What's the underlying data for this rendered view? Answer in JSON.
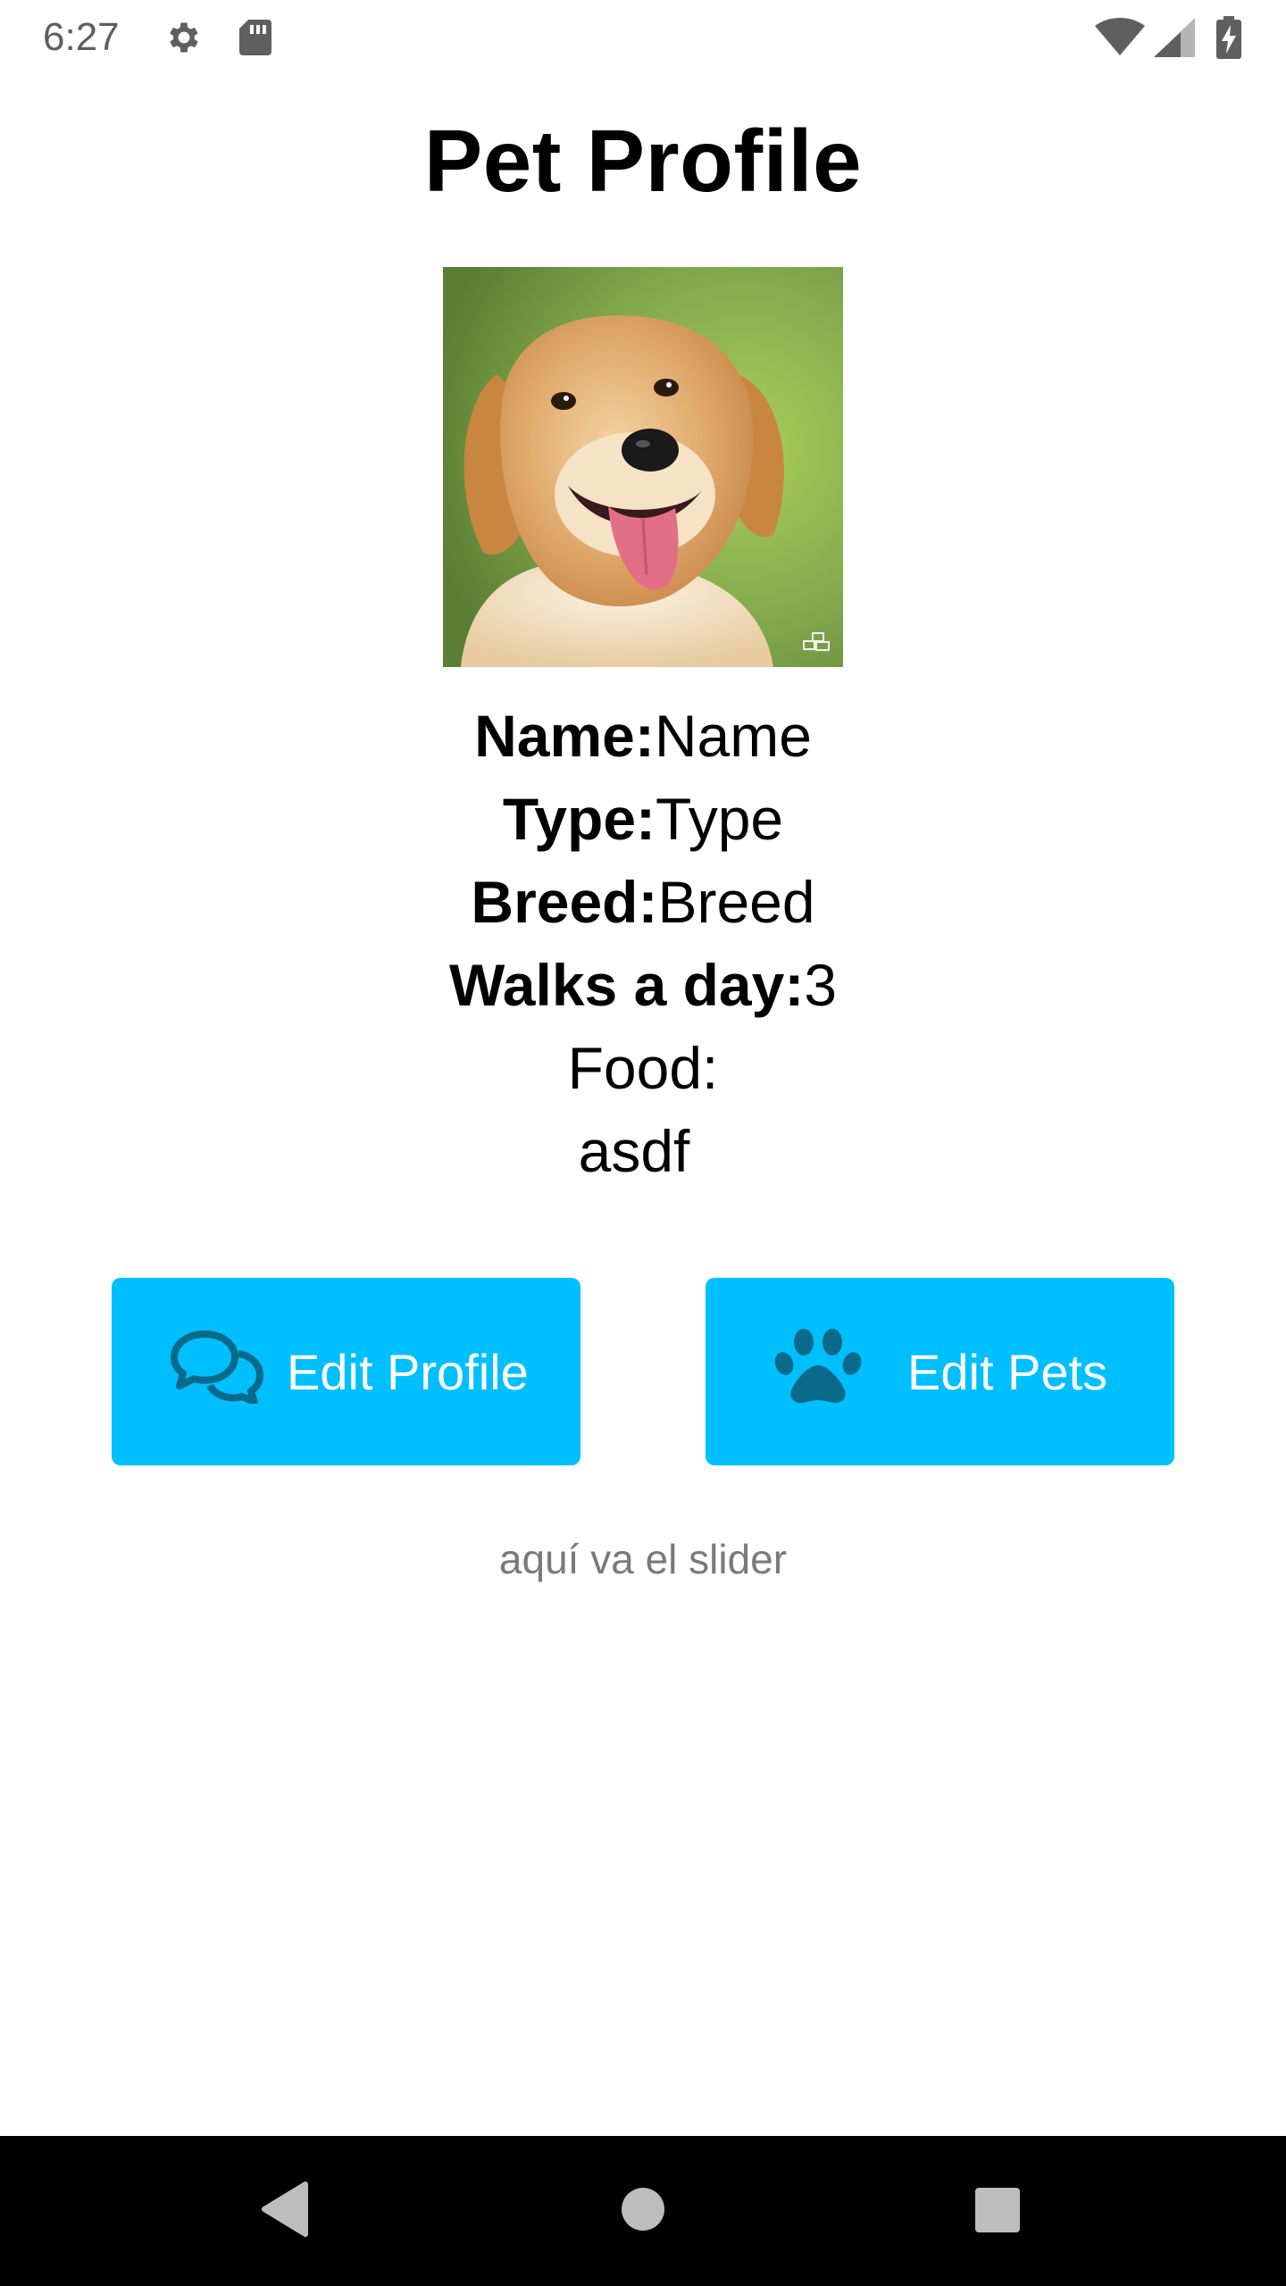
{
  "status_bar": {
    "time": "6:27",
    "icons": [
      "gear-icon",
      "sd-card-icon",
      "wifi-icon",
      "signal-icon",
      "battery-charging-icon"
    ]
  },
  "page": {
    "title": "Pet Profile"
  },
  "pet": {
    "photo": "dog-photo",
    "name_label": "Name:",
    "name_value": "Name",
    "type_label": "Type:",
    "type_value": "Type",
    "breed_label": "Breed:",
    "breed_value": "Breed",
    "walks_label": "Walks a day:",
    "walks_value": "3",
    "food_label": "Food:",
    "food_value": "asdf"
  },
  "buttons": {
    "edit_profile": {
      "label": "Edit Profile",
      "icon": "chat-bubbles-icon"
    },
    "edit_pets": {
      "label": "Edit Pets",
      "icon": "paw-icon"
    }
  },
  "slider_note": "aquí va el slider",
  "nav_bar": {
    "icons": [
      "back-icon",
      "home-icon",
      "recents-icon"
    ]
  },
  "colors": {
    "button_bg": "#00bfff",
    "button_icon": "#0a6a8a",
    "muted_text": "#7a7a7a",
    "status_icons": "#5f5f5f"
  }
}
